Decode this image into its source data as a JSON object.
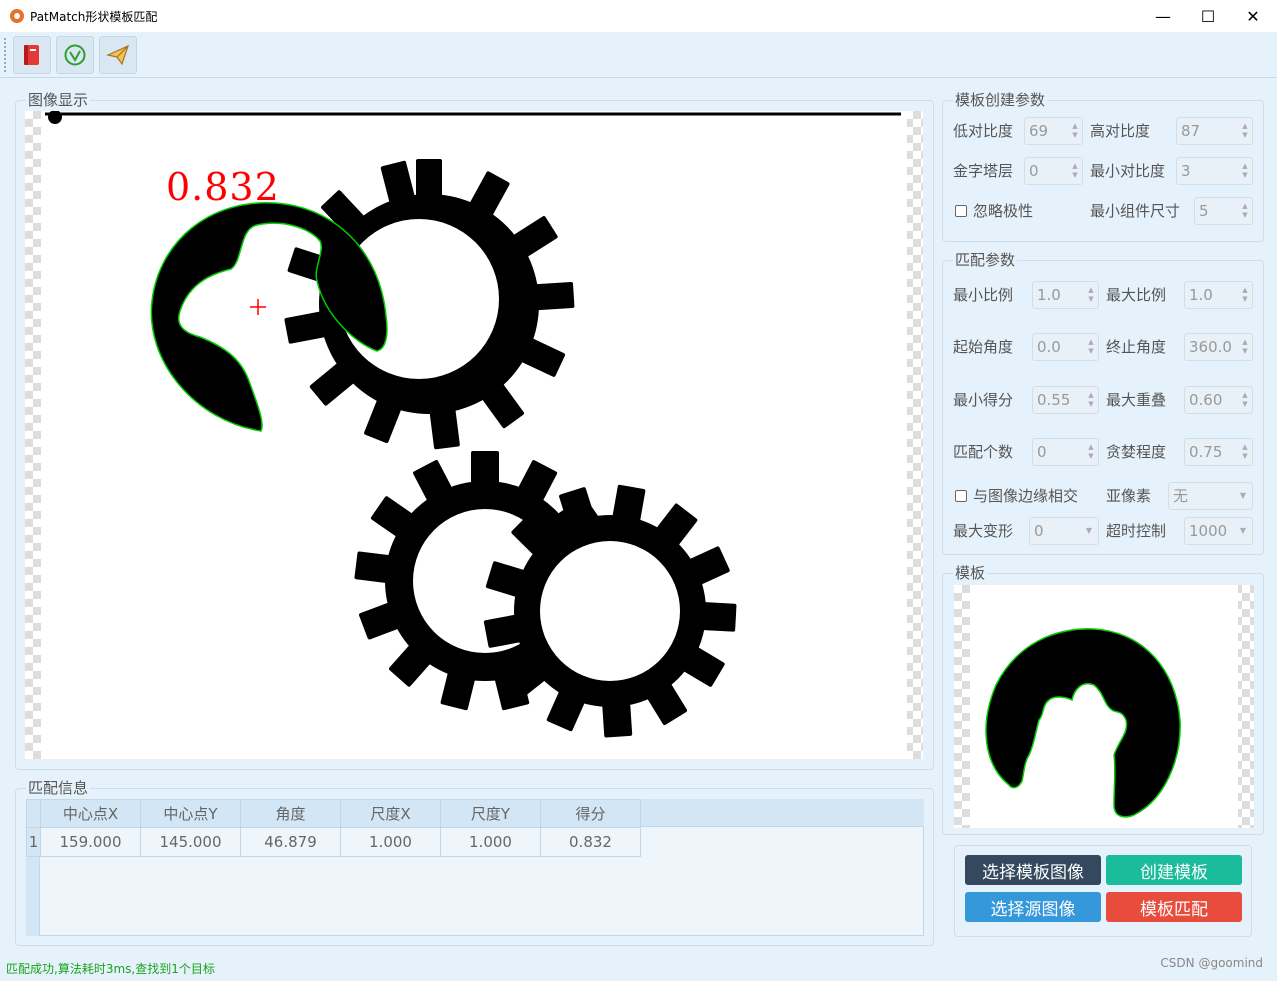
{
  "window": {
    "title": "PatMatch形状模板匹配",
    "minimize": "—",
    "maximize": "☐",
    "close": "✕"
  },
  "toolbar": {
    "buttons": [
      {
        "icon": "book-icon",
        "color": "#e53935"
      },
      {
        "icon": "check-circle-icon",
        "color": "#2e9e2e"
      },
      {
        "icon": "send-icon",
        "color": "#e0a030"
      }
    ]
  },
  "image_display": {
    "title": "图像显示",
    "score_label": "0.832",
    "colors": {
      "score": "#ff0000",
      "contour": "#00cc00",
      "marker": "#ff0000"
    }
  },
  "template_params": {
    "title": "模板创建参数",
    "low_contrast": {
      "label": "低对比度",
      "value": "69"
    },
    "high_contrast": {
      "label": "高对比度",
      "value": "87"
    },
    "pyramid_levels": {
      "label": "金字塔层",
      "value": "0"
    },
    "min_contrast": {
      "label": "最小对比度",
      "value": "3"
    },
    "ignore_polarity": {
      "label": "忽略极性",
      "checked": false
    },
    "min_component_size": {
      "label": "最小组件尺寸",
      "value": "5"
    }
  },
  "match_params": {
    "title": "匹配参数",
    "min_scale": {
      "label": "最小比例",
      "value": "1.0"
    },
    "max_scale": {
      "label": "最大比例",
      "value": "1.0"
    },
    "start_angle": {
      "label": "起始角度",
      "value": "0.0"
    },
    "end_angle": {
      "label": "终止角度",
      "value": "360.0"
    },
    "min_score": {
      "label": "最小得分",
      "value": "0.55"
    },
    "max_overlap": {
      "label": "最大重叠",
      "value": "0.60"
    },
    "num_matches": {
      "label": "匹配个数",
      "value": "0"
    },
    "greediness": {
      "label": "贪婪程度",
      "value": "0.75"
    },
    "border_intersect": {
      "label": "与图像边缘相交",
      "checked": false
    },
    "subpixel": {
      "label": "亚像素",
      "value": "无"
    },
    "max_deformation": {
      "label": "最大变形",
      "value": "0"
    },
    "timeout": {
      "label": "超时控制",
      "value": "1000"
    }
  },
  "template": {
    "title": "模板"
  },
  "match_info": {
    "title": "匹配信息",
    "columns": [
      "中心点X",
      "中心点Y",
      "角度",
      "尺度X",
      "尺度Y",
      "得分"
    ],
    "rows": [
      {
        "index": "1",
        "cells": [
          "159.000",
          "145.000",
          "46.879",
          "1.000",
          "1.000",
          "0.832"
        ]
      }
    ]
  },
  "actions": {
    "select_template": {
      "label": "选择模板图像",
      "color": "#34495e"
    },
    "create_template": {
      "label": "创建模板",
      "color": "#1abc9c"
    },
    "select_source": {
      "label": "选择源图像",
      "color": "#3498db"
    },
    "match_template": {
      "label": "模板匹配",
      "color": "#e74c3c"
    }
  },
  "status": {
    "message": "匹配成功,算法耗时3ms,查找到1个目标"
  },
  "watermark": "CSDN @goomind"
}
